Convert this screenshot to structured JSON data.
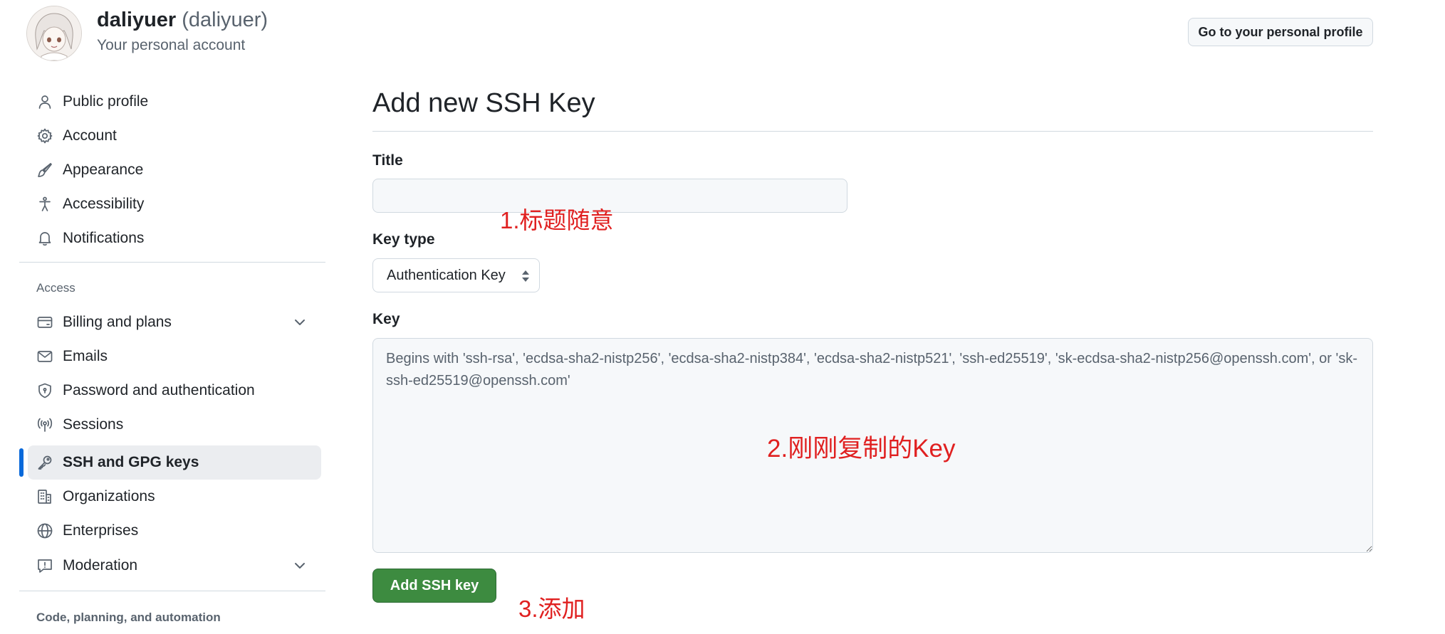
{
  "header": {
    "username": "daliyuer",
    "login": "(daliyuer)",
    "subtitle": "Your personal account",
    "profile_button": "Go to your personal profile"
  },
  "sidebar": {
    "group1": [
      {
        "label": "Public profile",
        "icon": "person-icon"
      },
      {
        "label": "Account",
        "icon": "gear-icon"
      },
      {
        "label": "Appearance",
        "icon": "paintbrush-icon"
      },
      {
        "label": "Accessibility",
        "icon": "accessibility-icon"
      },
      {
        "label": "Notifications",
        "icon": "bell-icon"
      }
    ],
    "access_title": "Access",
    "access_items": [
      {
        "label": "Billing and plans",
        "icon": "credit-card-icon",
        "expandable": true
      },
      {
        "label": "Emails",
        "icon": "mail-icon"
      },
      {
        "label": "Password and authentication",
        "icon": "shield-icon"
      },
      {
        "label": "Sessions",
        "icon": "broadcast-icon"
      },
      {
        "label": "SSH and GPG keys",
        "icon": "key-icon",
        "active": true
      },
      {
        "label": "Organizations",
        "icon": "organization-icon"
      },
      {
        "label": "Enterprises",
        "icon": "globe-icon"
      },
      {
        "label": "Moderation",
        "icon": "report-icon",
        "expandable": true
      }
    ],
    "code_section_title": "Code, planning, and automation"
  },
  "main": {
    "page_title": "Add new SSH Key",
    "title_label": "Title",
    "title_value": "",
    "key_type_label": "Key type",
    "key_type_value": "Authentication Key",
    "key_label": "Key",
    "key_placeholder": "Begins with 'ssh-rsa', 'ecdsa-sha2-nistp256', 'ecdsa-sha2-nistp384', 'ecdsa-sha2-nistp521', 'ssh-ed25519', 'sk-ecdsa-sha2-nistp256@openssh.com', or 'sk-ssh-ed25519@openssh.com'",
    "submit_button": "Add SSH key"
  },
  "annotations": {
    "note1": "1.标题随意",
    "note2": "2.刚刚复制的Key",
    "note3": "3.添加"
  },
  "colors": {
    "primary_button": "#3d8b40",
    "active_indicator": "#0969da",
    "annotation": "#e02020"
  }
}
